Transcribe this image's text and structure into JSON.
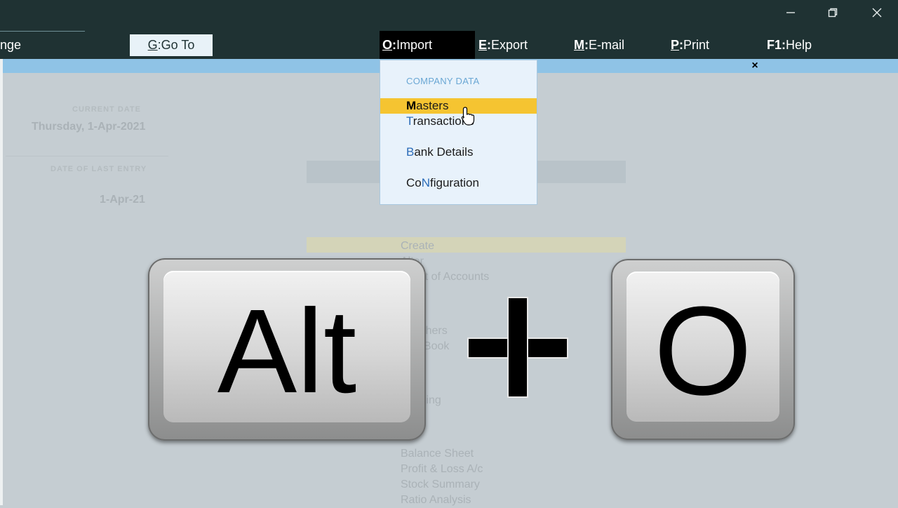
{
  "window": {
    "controls": {
      "minimize": "—",
      "restore": "❐",
      "close": "✕"
    }
  },
  "menu": {
    "change": {
      "label": "nge"
    },
    "goto": {
      "key": "G",
      "label": "Go To"
    },
    "import": {
      "key": "O",
      "label": "Import"
    },
    "export": {
      "key": "E",
      "label": "Export"
    },
    "email": {
      "key": "M",
      "label": "E-mail"
    },
    "print": {
      "key": "P",
      "label": "Print"
    },
    "help": {
      "key": "F1",
      "label": "Help"
    }
  },
  "subbar": {
    "close_label": "×"
  },
  "background": {
    "current_date_label": "CURRENT DATE",
    "current_date": "Thursday, 1-Apr-2021",
    "last_entry_label": "DATE OF LAST ENTRY",
    "last_entry_date": "1-Apr-21",
    "masters_list": [
      "Create",
      "Alter",
      "Chart of Accounts"
    ],
    "transactions_list": [
      "Vouchers",
      "Day Book"
    ],
    "utilities_list": [
      "Banking"
    ],
    "reports_list": [
      "Balance Sheet",
      "Profit & Loss A/c",
      "Stock Summary",
      "Ratio Analysis"
    ]
  },
  "dropdown": {
    "header": "COMPANY DATA",
    "items": [
      {
        "hotkey": "M",
        "rest": "asters",
        "prefix": ""
      },
      {
        "hotkey": "T",
        "rest": "ransactions",
        "prefix": ""
      },
      {
        "hotkey": "B",
        "rest": "ank Details",
        "prefix": ""
      },
      {
        "hotkey": "N",
        "rest": "figuration",
        "prefix": "Co"
      }
    ],
    "active_index": 0
  },
  "overlay": {
    "key1": "Alt",
    "plus": "+",
    "key2": "O"
  },
  "colors": {
    "titlebar": "#1f3233",
    "subbar": "#8fc3e6",
    "highlight": "#f5c431",
    "hotkey": "#2b6cb8"
  }
}
